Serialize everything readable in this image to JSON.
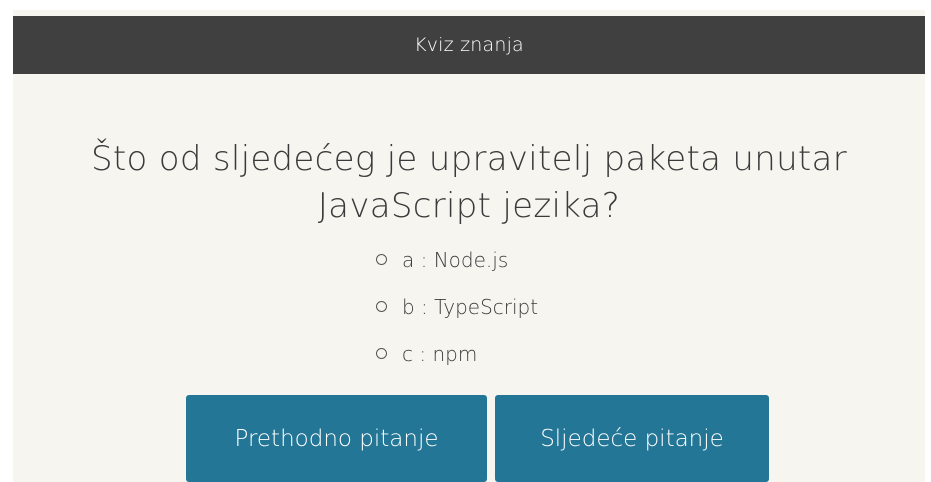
{
  "header": {
    "title": "Kviz znanja"
  },
  "question": {
    "text": "Što od sljedećeg je upravitelj paketa unutar JavaScript jezika?"
  },
  "answers": [
    {
      "label": "a : Node.js"
    },
    {
      "label": "b : TypeScript"
    },
    {
      "label": "c : npm"
    }
  ],
  "buttons": {
    "previous_label": "Prethodno pitanje",
    "next_label": "Sljedeće pitanje"
  },
  "colors": {
    "header_bg": "#404040",
    "page_bg": "#f6f5f0",
    "button_bg": "#237696",
    "text": "#3a3a3a"
  }
}
